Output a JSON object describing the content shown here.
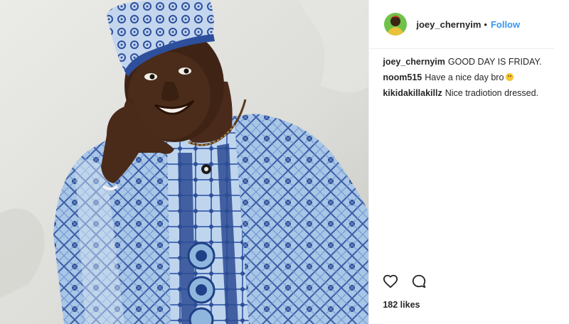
{
  "post": {
    "image": {
      "alt_icon": "post-photo"
    },
    "author": {
      "username": "joey_chernyim",
      "separator": "•",
      "follow_label": "Follow",
      "avatar_icon": "user-avatar"
    },
    "comments": [
      {
        "user": "joey_chernyim",
        "text": "GOOD DAY IS FRIDAY.",
        "emoji": false
      },
      {
        "user": "noom515",
        "text": "Have a nice day bro",
        "emoji": true
      },
      {
        "user": "kikidakillakillz",
        "text": "Nice tradiotion dressed.",
        "emoji": false
      }
    ],
    "actions": {
      "like_icon": "heart-icon",
      "comment_icon": "comment-icon",
      "likes_text": "182 likes"
    }
  },
  "colors": {
    "link": "#3897f0",
    "text": "#262626",
    "divider": "#efefef"
  }
}
